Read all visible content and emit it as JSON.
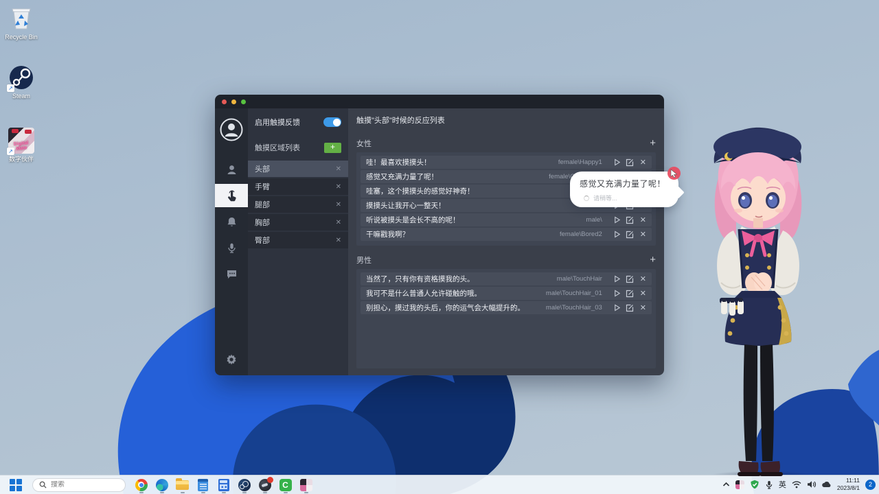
{
  "icons": {
    "close": "✕",
    "plus": "+"
  },
  "desktop": {
    "icons": [
      {
        "name": "recycle-bin",
        "label": "Recycle Bin"
      },
      {
        "name": "steam",
        "label": "Steam"
      },
      {
        "name": "digital-mate",
        "label": "数字伙伴",
        "badge_text": "Digital Mate"
      }
    ]
  },
  "window": {
    "panel": {
      "toggle_label": "启用触摸反馈",
      "toggle_on": true,
      "list_header": "触摸区域列表",
      "areas": [
        {
          "label": "头部",
          "active": true
        },
        {
          "label": "手臂",
          "active": false
        },
        {
          "label": "腿部",
          "active": false
        },
        {
          "label": "胸部",
          "active": false
        },
        {
          "label": "臀部",
          "active": false
        }
      ]
    },
    "main": {
      "title": "触摸\"头部\"时候的反应列表",
      "sections": [
        {
          "label": "女性",
          "rows": [
            {
              "text": "哇！最喜欢摸摸头！",
              "tag": "female\\Happy1"
            },
            {
              "text": "感觉又充满力量了呢！",
              "tag": "female\\Charming1"
            },
            {
              "text": "哇塞，这个摸摸头的感觉好神奇！",
              "tag": ""
            },
            {
              "text": "摸摸头让我开心一整天！",
              "tag": ""
            },
            {
              "text": "听说被摸头是会长不高的呢！",
              "tag": "male\\"
            },
            {
              "text": "干嘛戳我啊？",
              "tag": "female\\Bored2"
            }
          ]
        },
        {
          "label": "男性",
          "rows": [
            {
              "text": "当然了，只有你有资格摸我的头。",
              "tag": "male\\TouchHair"
            },
            {
              "text": "我可不是什么普通人允许碰触的哦。",
              "tag": "male\\TouchHair_01"
            },
            {
              "text": "别担心，摸过我的头后，你的运气会大幅提升的。",
              "tag": "male\\TouchHair_03"
            }
          ]
        }
      ]
    }
  },
  "bubble": {
    "text": "感觉又充满力量了呢！",
    "sub": "请稍等..."
  },
  "taskbar": {
    "search_placeholder": "搜索",
    "apps": [
      "chrome",
      "edge",
      "file-explorer",
      "notepad",
      "calculator",
      "steam",
      "dark-app",
      "c-app",
      "digital-mate"
    ]
  },
  "tray": {
    "ime": "英",
    "time": "11:11",
    "date": "2023/8/1",
    "badge": "2"
  }
}
